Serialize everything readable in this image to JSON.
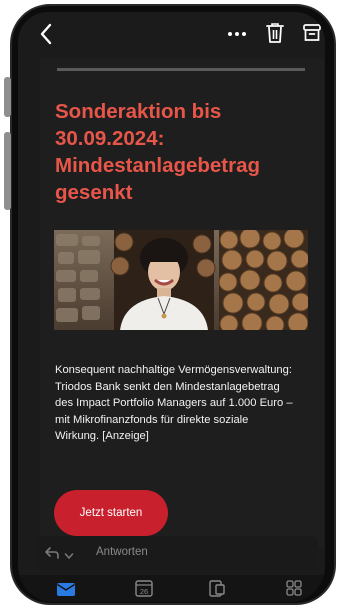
{
  "email": {
    "headline_lines": [
      "Sonderaktion bis",
      "30.09.2024:",
      "Mindestanlagebetrag",
      "gesenkt"
    ],
    "body_lines": [
      "Konsequent nachhaltige Vermögensverwaltung:",
      "Triodos Bank senkt den Mindestanlagebetrag",
      "des Impact Portfolio Managers auf 1.000 Euro –",
      "mit Mikrofinanzfonds für direkte soziale",
      "Wirkung. [Anzeige]"
    ],
    "cta_label": "Jetzt starten"
  },
  "reply_bar": {
    "label": "Antworten"
  },
  "tabbar": {
    "calendar_day": "26"
  },
  "icons": {
    "back": "chevron-left",
    "more": "ellipsis",
    "trash": "trash",
    "archive": "archive-box",
    "reply": "reply-arrow",
    "chevron": "chevron-down",
    "mail": "envelope",
    "calendar": "calendar",
    "files": "files",
    "apps": "grid"
  },
  "colors": {
    "accent": "#e8564a",
    "cta": "#c8202d",
    "mail_tab": "#2a7ae4",
    "background": "#1b1b1c"
  }
}
